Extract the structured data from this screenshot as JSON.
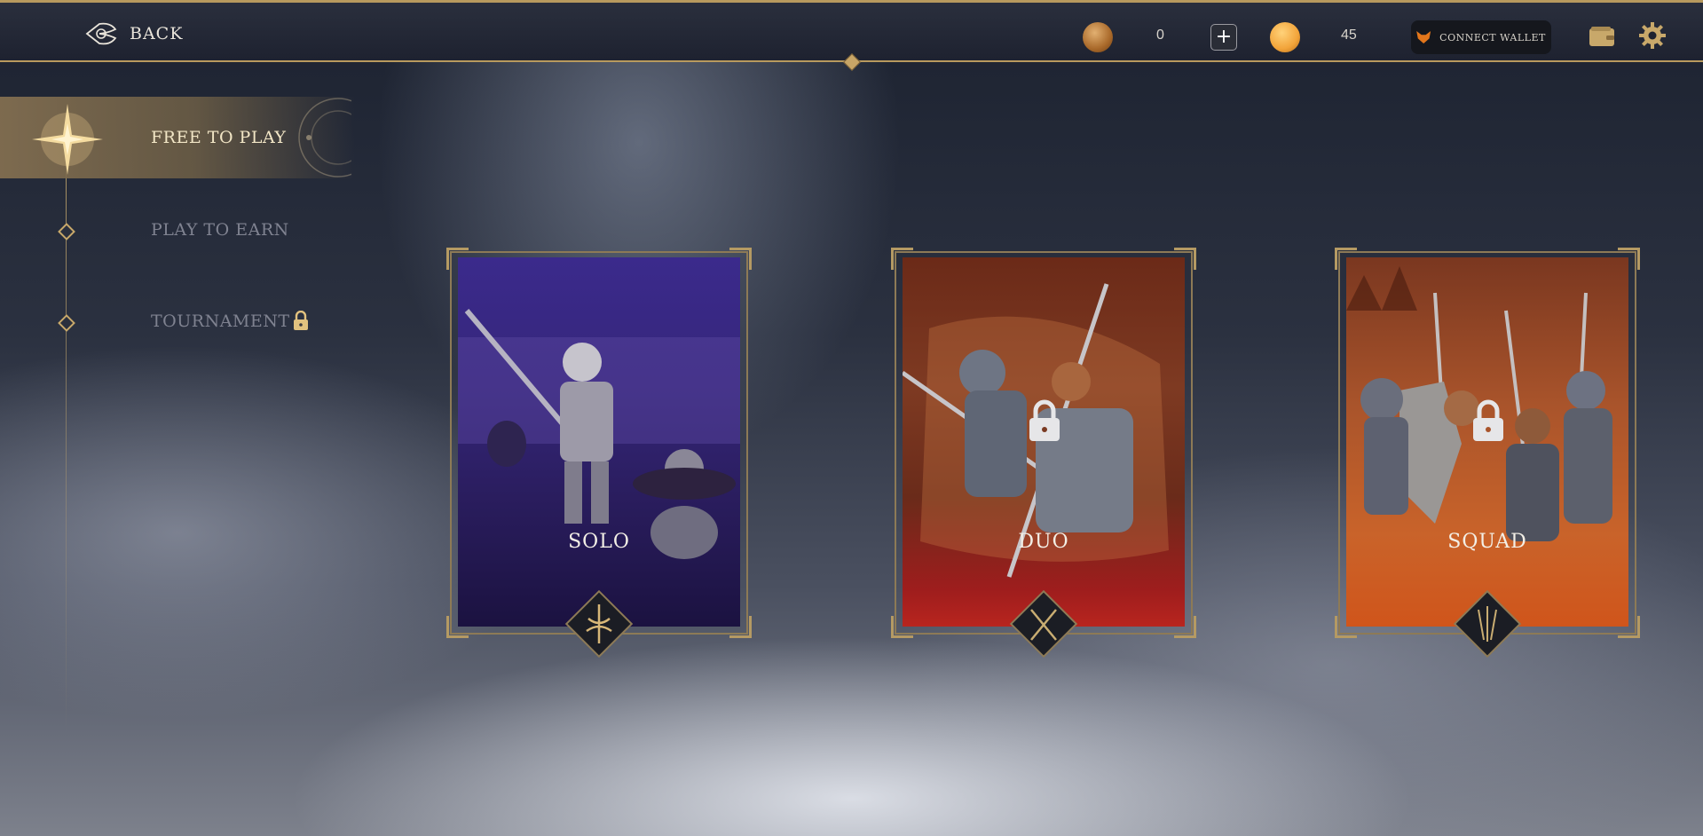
{
  "header": {
    "back_label": "BACK",
    "coin_a_value": "0",
    "coin_b_value": "45",
    "add_label": "+",
    "wallet_label": "CONNECT WALLET"
  },
  "sidebar": {
    "items": [
      {
        "label": "FREE TO PLAY",
        "active": true
      },
      {
        "label": "PLAY TO EARN",
        "active": false
      },
      {
        "label": "TOURNAMENT",
        "active": false,
        "locked": true
      }
    ]
  },
  "modes": [
    {
      "title": "SOLO",
      "locked": false,
      "theme": "#35267a"
    },
    {
      "title": "DUO",
      "locked": true,
      "theme": "#7e3a22"
    },
    {
      "title": "SQUAD",
      "locked": true,
      "theme": "#c9632a"
    }
  ],
  "colors": {
    "gold": "#c8a86a",
    "bar": "#1e2230"
  },
  "icons": [
    "celtic-knot-back-icon",
    "coin-icon",
    "plus-icon",
    "fox-icon",
    "wallet-icon",
    "gear-icon",
    "compass-star-icon",
    "lock-icon"
  ]
}
